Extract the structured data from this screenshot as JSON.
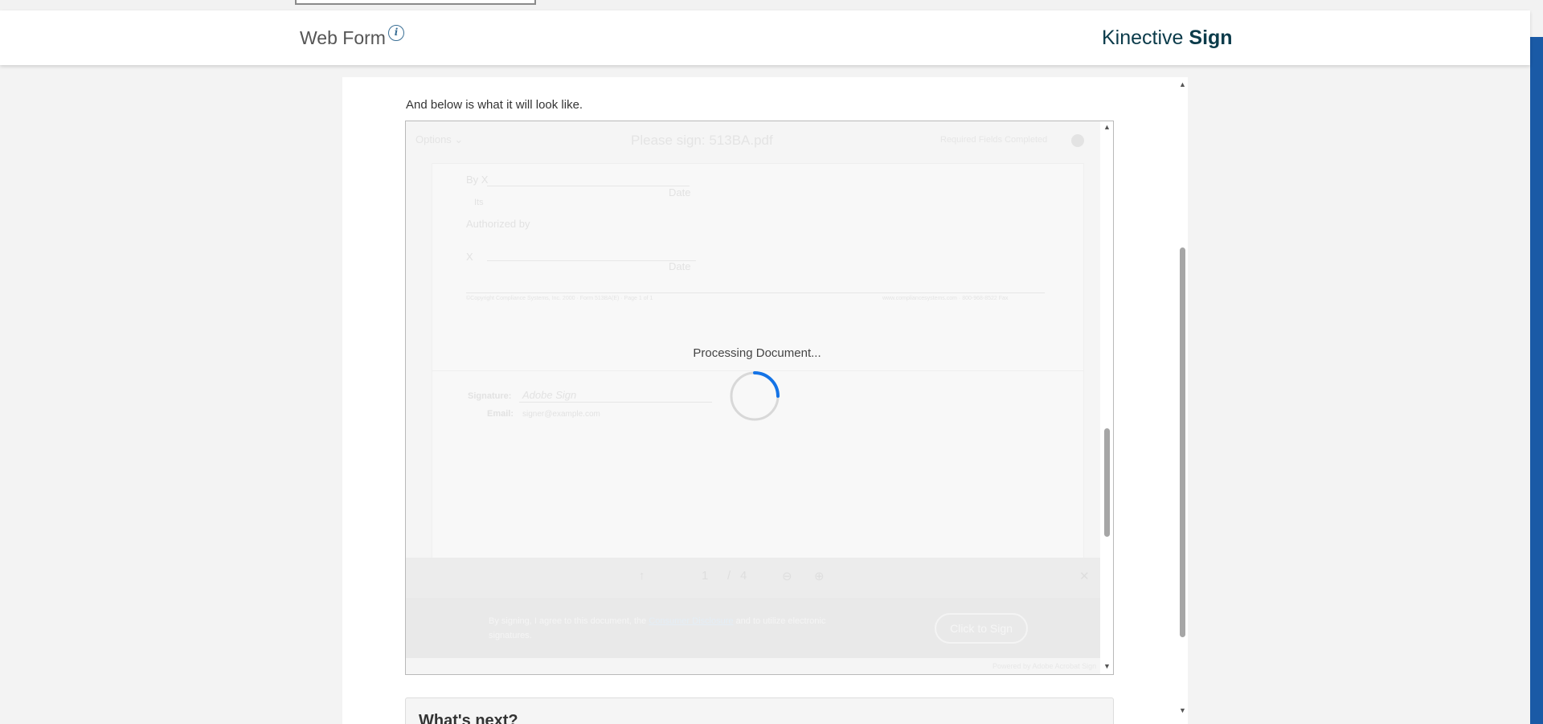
{
  "header": {
    "title": "Web Form",
    "info_icon": "i",
    "brand_light": "Kinective",
    "brand_bold": "Sign"
  },
  "content": {
    "intro": "And below is what it will look like."
  },
  "document": {
    "options_label": "Options",
    "doc_title": "Please sign: 513BA.pdf",
    "required_label": "Required Fields Completed",
    "page1": {
      "by_x": "By X",
      "date1": "Date",
      "its": "Its",
      "authorized_by": "Authorized by",
      "x": "X",
      "date2": "Date",
      "footer_left": "©Copyright Compliance Systems, Inc. 2000 · Form 513BA(E) · Page 1 of 1",
      "footer_right": "www.compliancesystems.com · 800-968-8522 Fax"
    },
    "page2": {
      "signature_label": "Signature:",
      "signature_value": "Adobe Sign",
      "email_label": "Email:",
      "email_value": "signer@example.com"
    },
    "processing": "Processing Document...",
    "toolbar": {
      "page_current": "1",
      "page_sep": "/",
      "page_total": "4"
    },
    "signbar": {
      "text_before": "By signing, I agree to this document, the",
      "link": "Consumer Disclosure",
      "text_after": "and to utilize electronic signatures.",
      "button": "Click to Sign"
    },
    "powered_by": "Powered by Adobe Acrobat Sign"
  },
  "next": {
    "heading": "What's next?"
  },
  "colors": {
    "brand": "#0b3b4a",
    "accent_bar": "#1a5aa6",
    "spinner": "#1473e6"
  }
}
